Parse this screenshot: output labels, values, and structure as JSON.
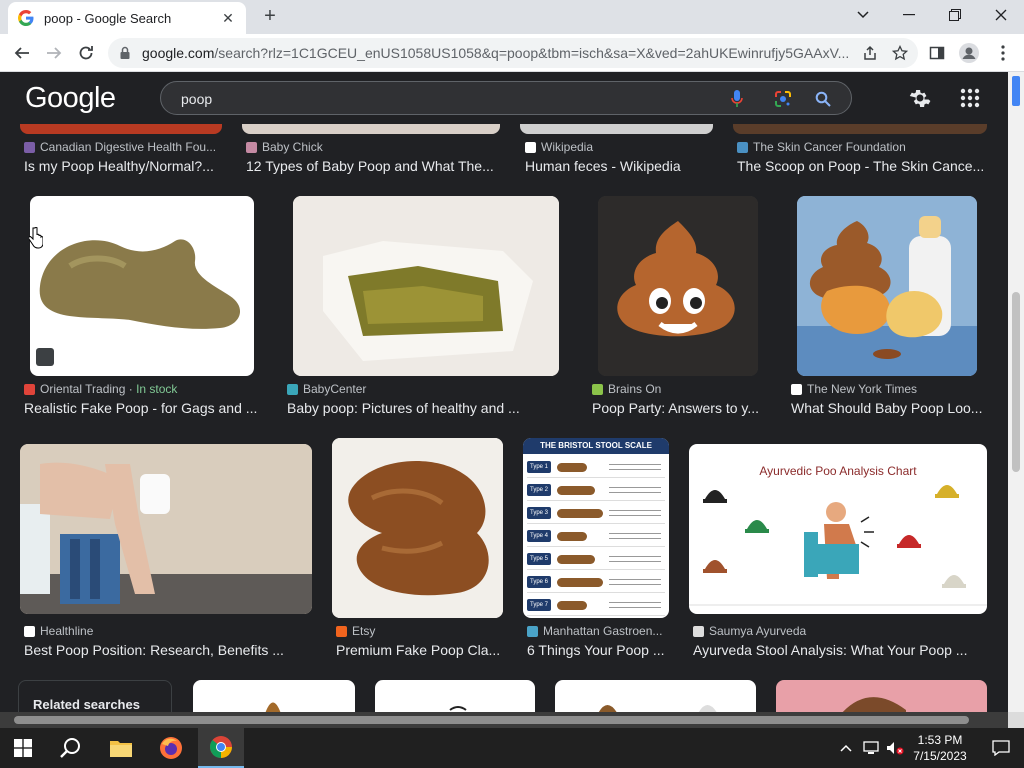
{
  "browser": {
    "tab_title": "poop - Google Search",
    "url_host": "google.com",
    "url_rest": "/search?rlz=1C1GCEU_enUS1058US1058&q=poop&tbm=isch&sa=X&ved=2ahUKEwinrufjy5GAAxV..."
  },
  "google": {
    "logo": "Google",
    "query": "poop"
  },
  "results": [
    {
      "source": "Canadian Digestive Health Fou...",
      "caption": "Is my Poop Healthy/Normal?...",
      "fav_color": "#7b5ea7"
    },
    {
      "source": "Baby Chick",
      "caption": "12 Types of Baby Poop and What The...",
      "fav_color": "#c48aa3"
    },
    {
      "source": "Wikipedia",
      "caption": "Human feces - Wikipedia",
      "fav_color": "#ffffff"
    },
    {
      "source": "The Skin Cancer Foundation",
      "caption": "The Scoop on Poop - The Skin Cance...",
      "fav_color": "#4a90c2"
    },
    {
      "source": "Oriental Trading",
      "source_sep": " · ",
      "stock": "In stock",
      "caption": "Realistic Fake Poop - for Gags and ...",
      "fav_color": "#e0443a"
    },
    {
      "source": "BabyCenter",
      "caption": "Baby poop: Pictures of healthy and ...",
      "fav_color": "#3aa6b9"
    },
    {
      "source": "Brains On",
      "caption": "Poop Party: Answers to y...",
      "fav_color": "#8bc34a"
    },
    {
      "source": "The New York Times",
      "caption": "What Should Baby Poop Loo...",
      "fav_color": "#ffffff"
    },
    {
      "source": "Healthline",
      "caption": "Best Poop Position: Research, Benefits ...",
      "fav_color": "#ffffff"
    },
    {
      "source": "Etsy",
      "caption": "Premium Fake Poop Cla...",
      "fav_color": "#f1641e"
    },
    {
      "source": "Manhattan Gastroen...",
      "caption": "6 Things Your Poop ...",
      "fav_color": "#4aa3c7"
    },
    {
      "source": "Saumya Ayurveda",
      "caption": "Ayurveda Stool Analysis: What Your Poop ...",
      "fav_color": "#dddddd"
    }
  ],
  "bristol": {
    "title": "THE BRISTOL STOOL SCALE",
    "types": [
      "Type 1",
      "Type 2",
      "Type 3",
      "Type 4",
      "Type 5",
      "Type 6",
      "Type 7"
    ]
  },
  "ayurvedic": {
    "title": "Ayurvedic Poo Analysis Chart"
  },
  "related_searches": "Related searches",
  "taskbar": {
    "time": "1:53 PM",
    "date": "7/15/2023"
  }
}
